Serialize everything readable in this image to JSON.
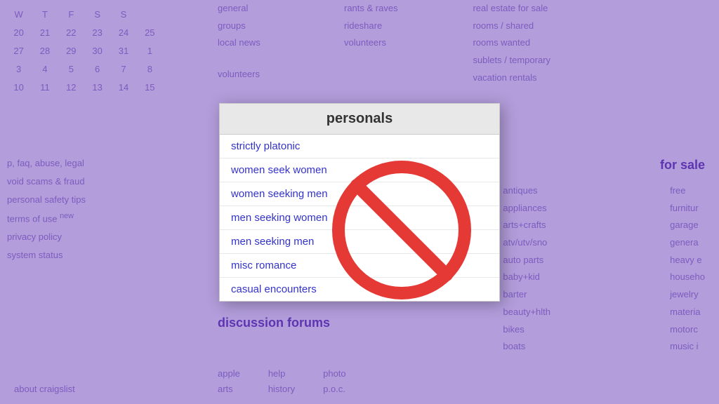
{
  "background": {
    "calendar": {
      "headers": [
        "W",
        "T",
        "F",
        "S",
        "S"
      ],
      "rows": [
        [
          "20",
          "21",
          "22",
          "23",
          "24",
          "25"
        ],
        [
          "27",
          "28",
          "29",
          "30",
          "31",
          "1"
        ],
        [
          "3",
          "4",
          "5",
          "6",
          "7",
          "8"
        ],
        [
          "10",
          "11",
          "12",
          "13",
          "14",
          "15"
        ]
      ]
    },
    "left_links": [
      "p, faq, abuse, legal",
      "void scams & fraud",
      "personal safety tips",
      "terms of use  new",
      "privacy policy",
      "system status"
    ],
    "center_col1": [
      "general",
      "groups",
      "local news",
      "volunteers"
    ],
    "center_col2": [
      "rants & raves",
      "rideshare",
      "volunteers"
    ],
    "right_col1": [
      "real estate for sale",
      "rooms / shared",
      "rooms wanted",
      "sublets / temporary",
      "vacation rentals"
    ],
    "right_col2_forsale": "for sale",
    "right_col2": [
      "antiques",
      "appliances",
      "arts+crafts",
      "atv/utv/sno",
      "auto parts",
      "baby+kid",
      "barter",
      "beauty+hlth",
      "bikes",
      "boats"
    ],
    "right_col3": [
      "free",
      "furnitur",
      "garage",
      "genera",
      "heavy e",
      "househo",
      "jewelry",
      "materia",
      "motorc",
      "music i"
    ],
    "discussion_forums": "discussion forums",
    "forum_links_col1": [
      "apple",
      "arts"
    ],
    "forum_links_col2": [
      "help",
      "history"
    ],
    "forum_links_col3": [
      "photo",
      "p.o.c."
    ],
    "about": "about craigslist"
  },
  "modal": {
    "title": "personals",
    "items": [
      "strictly platonic",
      "women seek women",
      "women seeking men",
      "men seeking women",
      "men seeking men",
      "misc romance",
      "casual encounters"
    ]
  }
}
